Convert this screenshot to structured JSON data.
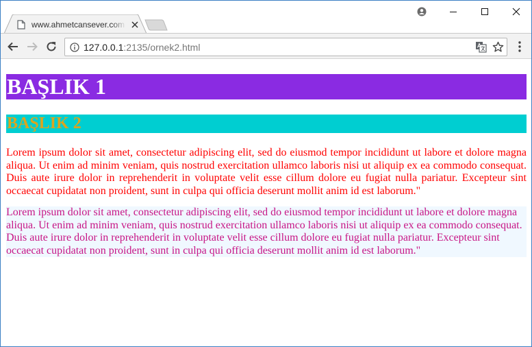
{
  "browser": {
    "tab": {
      "title": "www.ahmetcansever.com"
    },
    "address_bar": {
      "url_host": "127.0.0.1",
      "url_rest": ":2135/ornek2.html"
    }
  },
  "page": {
    "heading1": "BAŞLIK 1",
    "heading2": "BAŞLIK 2",
    "paragraph1": "Lorem ipsum dolor sit amet, consectetur adipiscing elit, sed do eiusmod tempor incididunt ut labore et dolore magna aliqua. Ut enim ad minim veniam, quis nostrud exercitation ullamco laboris nisi ut aliquip ex ea commodo consequat. Duis aute irure dolor in reprehenderit in voluptate velit esse cillum dolore eu fugiat nulla pariatur. Excepteur sint occaecat cupidatat non proident, sunt in culpa qui officia deserunt mollit anim id est laborum.\"",
    "paragraph2": "Lorem ipsum dolor sit amet, consectetur adipiscing elit, sed do eiusmod tempor incididunt ut labore et dolore magna aliqua. Ut enim ad minim veniam, quis nostrud exercitation ullamco laboris nisi ut aliquip ex ea commodo consequat. Duis aute irure dolor in reprehenderit in voluptate velit esse cillum dolore eu fugiat nulla pariatur. Excepteur sint occaecat cupidatat non proident, sunt in culpa qui officia deserunt mollit anim id est laborum.\""
  },
  "icons": {
    "tab_favicon": "page-icon",
    "tab_close": "close-icon",
    "profile": "user-icon",
    "minimize": "minimize-icon",
    "maximize": "maximize-icon",
    "close_window": "close-icon",
    "back": "back-arrow-icon",
    "forward": "forward-arrow-icon",
    "reload": "reload-icon",
    "site_info": "info-icon",
    "translate": "translate-icon",
    "bookmark": "star-icon",
    "menu": "kebab-menu-icon"
  },
  "colors": {
    "heading1_bg": "#8a2be2",
    "heading1_text": "#ffffff",
    "heading2_bg": "#00ced1",
    "heading2_text": "#daa520",
    "paragraph1_text": "#ff0000",
    "paragraph2_text": "#c71585",
    "paragraph2_bg": "#f0f8ff",
    "window_border": "#3b7fc4"
  }
}
